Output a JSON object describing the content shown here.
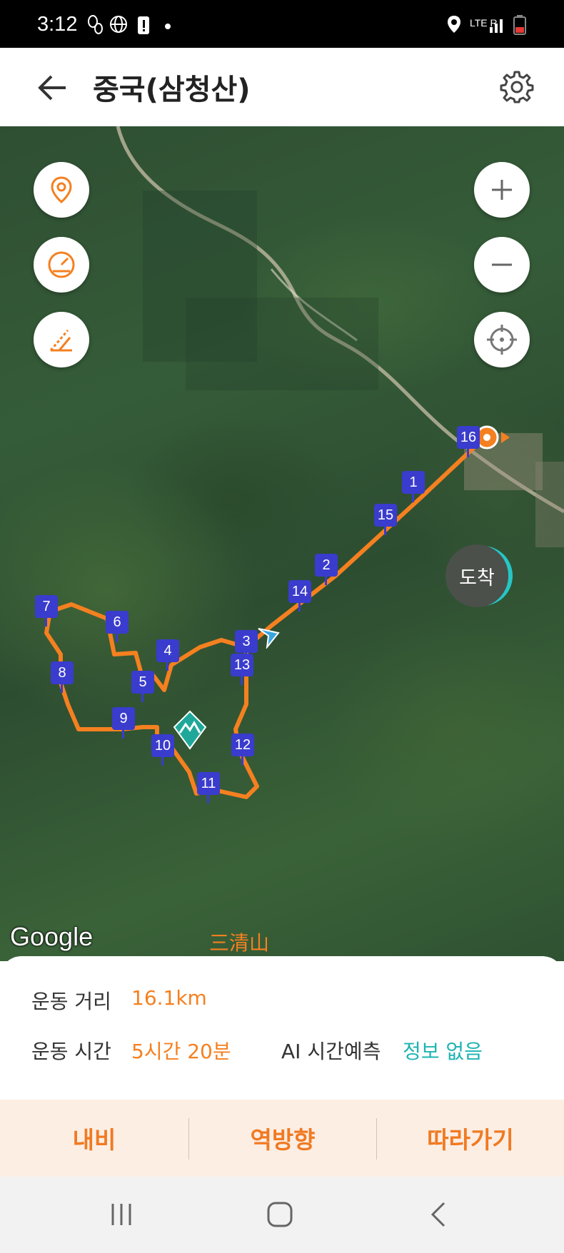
{
  "status_bar": {
    "time": "3:12",
    "network": "LTE R"
  },
  "header": {
    "title": "중국(삼청산)"
  },
  "map": {
    "attribution": "Google",
    "arrival_label": "도착",
    "mountain_label": "三清山",
    "waypoints": [
      "1",
      "2",
      "3",
      "4",
      "5",
      "6",
      "7",
      "8",
      "9",
      "10",
      "11",
      "12",
      "13",
      "14",
      "15",
      "16"
    ]
  },
  "stats": {
    "distance_label": "운동 거리",
    "distance_value": "16.1km",
    "time_label": "운동 시간",
    "time_value": "5시간 20분",
    "ai_label": "AI 시간예측",
    "ai_value": "정보 없음"
  },
  "actions": {
    "navi": "내비",
    "reverse": "역방향",
    "follow": "따라가기"
  },
  "colors": {
    "accent": "#f58020",
    "teal": "#1fb3b3",
    "marker": "#3a3ccd"
  }
}
